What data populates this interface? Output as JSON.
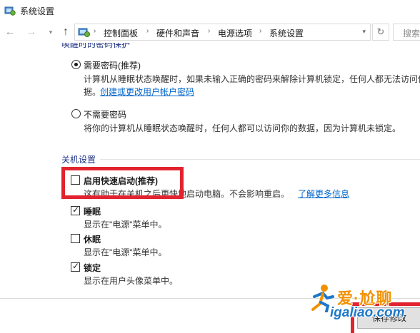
{
  "window": {
    "title": "系统设置"
  },
  "nav": {
    "breadcrumb": [
      "控制面板",
      "硬件和声音",
      "电源选项",
      "系统设置"
    ],
    "search_placeholder": "搜索"
  },
  "password_section": {
    "cut_heading": "唤醒时的密码保护",
    "require": {
      "label": "需要密码(推荐)",
      "selected": true,
      "desc_line1": "计算机从睡眠状态唤醒时，如果未输入正确的密码来解除计算机锁定，任何人都无法访问你的数",
      "desc_line2": "据。",
      "link": "创建或更改用户帐户密码"
    },
    "no_require": {
      "label": "不需要密码",
      "selected": false,
      "desc": "将你的计算机从睡眠状态唤醒时，任何人都可以访问你的数据，因为计算机未锁定。"
    }
  },
  "shutdown_section": {
    "title": "关机设置",
    "items": [
      {
        "label": "启用快速启动(推荐)",
        "checked": false,
        "desc": "这有助于在关机之后更快地启动电脑。不会影响重启。",
        "link": "了解更多信息"
      },
      {
        "label": "睡眠",
        "checked": true,
        "desc": "显示在\"电源\"菜单中。"
      },
      {
        "label": "休眠",
        "checked": false,
        "desc": "显示在\"电源\"菜单中。"
      },
      {
        "label": "锁定",
        "checked": true,
        "desc": "显示在用户头像菜单中。"
      }
    ]
  },
  "footer": {
    "save_label": "保存修改"
  },
  "watermark": {
    "title": "爱·尬聊",
    "url": "igaliao.com"
  },
  "colors": {
    "highlight": "#e2232f",
    "link": "#0066cc",
    "group_heading": "#1e3287"
  }
}
